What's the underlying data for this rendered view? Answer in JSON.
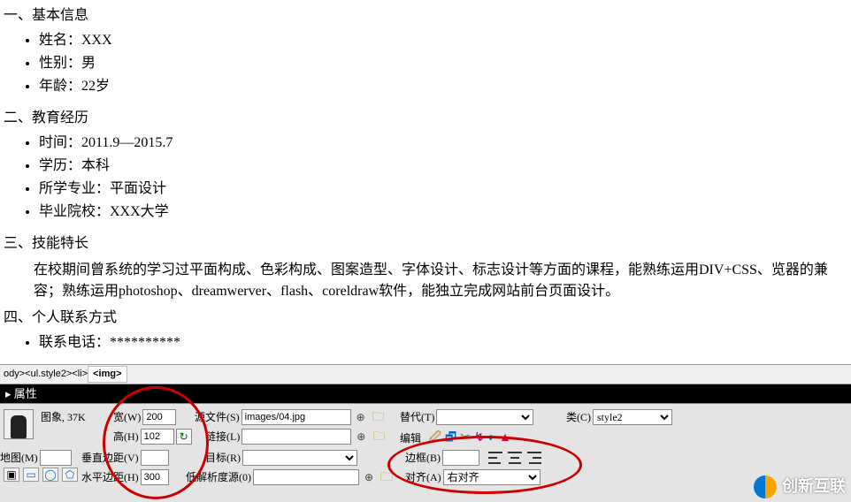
{
  "doc": {
    "s1_title": "一、基本信息",
    "s1_items": [
      "姓名：XXX",
      "性别：男",
      "年龄：22岁"
    ],
    "s2_title": "二、教育经历",
    "s2_items": [
      "时间：2011.9—2015.7",
      "学历：本科",
      "所学专业：平面设计",
      "毕业院校：XXX大学"
    ],
    "s3_title": "三、技能特长",
    "s3_para": "在校期间曾系统的学习过平面构成、色彩构成、图案造型、字体设计、标志设计等方面的课程，能熟练运用DIV+CSS、览器的兼容；熟练运用photoshop、dreamwerver、flash、coreldraw软件，能独立完成网站前台页面设计。",
    "s4_title": "四、个人联系方式",
    "s4_items": [
      "联系电话：**********"
    ]
  },
  "breadcrumb": {
    "path": "ody><ul.style2><li>",
    "sel": "<img>"
  },
  "panel": {
    "title": "属性",
    "image_label": "图象, 37K",
    "w_label": "宽(W)",
    "w_val": "200",
    "h_label": "高(H)",
    "h_val": "102",
    "src_label": "源文件(S)",
    "src_val": "images/04.jpg",
    "link_label": "链接(L)",
    "link_val": "",
    "alt_label": "替代(T)",
    "alt_val": "",
    "class_label": "类(C)",
    "class_val": "style2",
    "edit_label": "编辑",
    "map_label": "地图(M)",
    "map_val": "",
    "vspace_label": "垂直边距(V)",
    "vspace_val": "",
    "hspace_label": "水平边距(H)",
    "hspace_val": "300",
    "target_label": "目标(R)",
    "target_val": "",
    "border_label": "边框(B)",
    "border_val": "",
    "lowsrc_label": "低解析度源(0)",
    "lowsrc_val": "",
    "align_label": "对齐(A)",
    "align_val": "右对齐"
  },
  "logo": {
    "text": "创新互联"
  }
}
